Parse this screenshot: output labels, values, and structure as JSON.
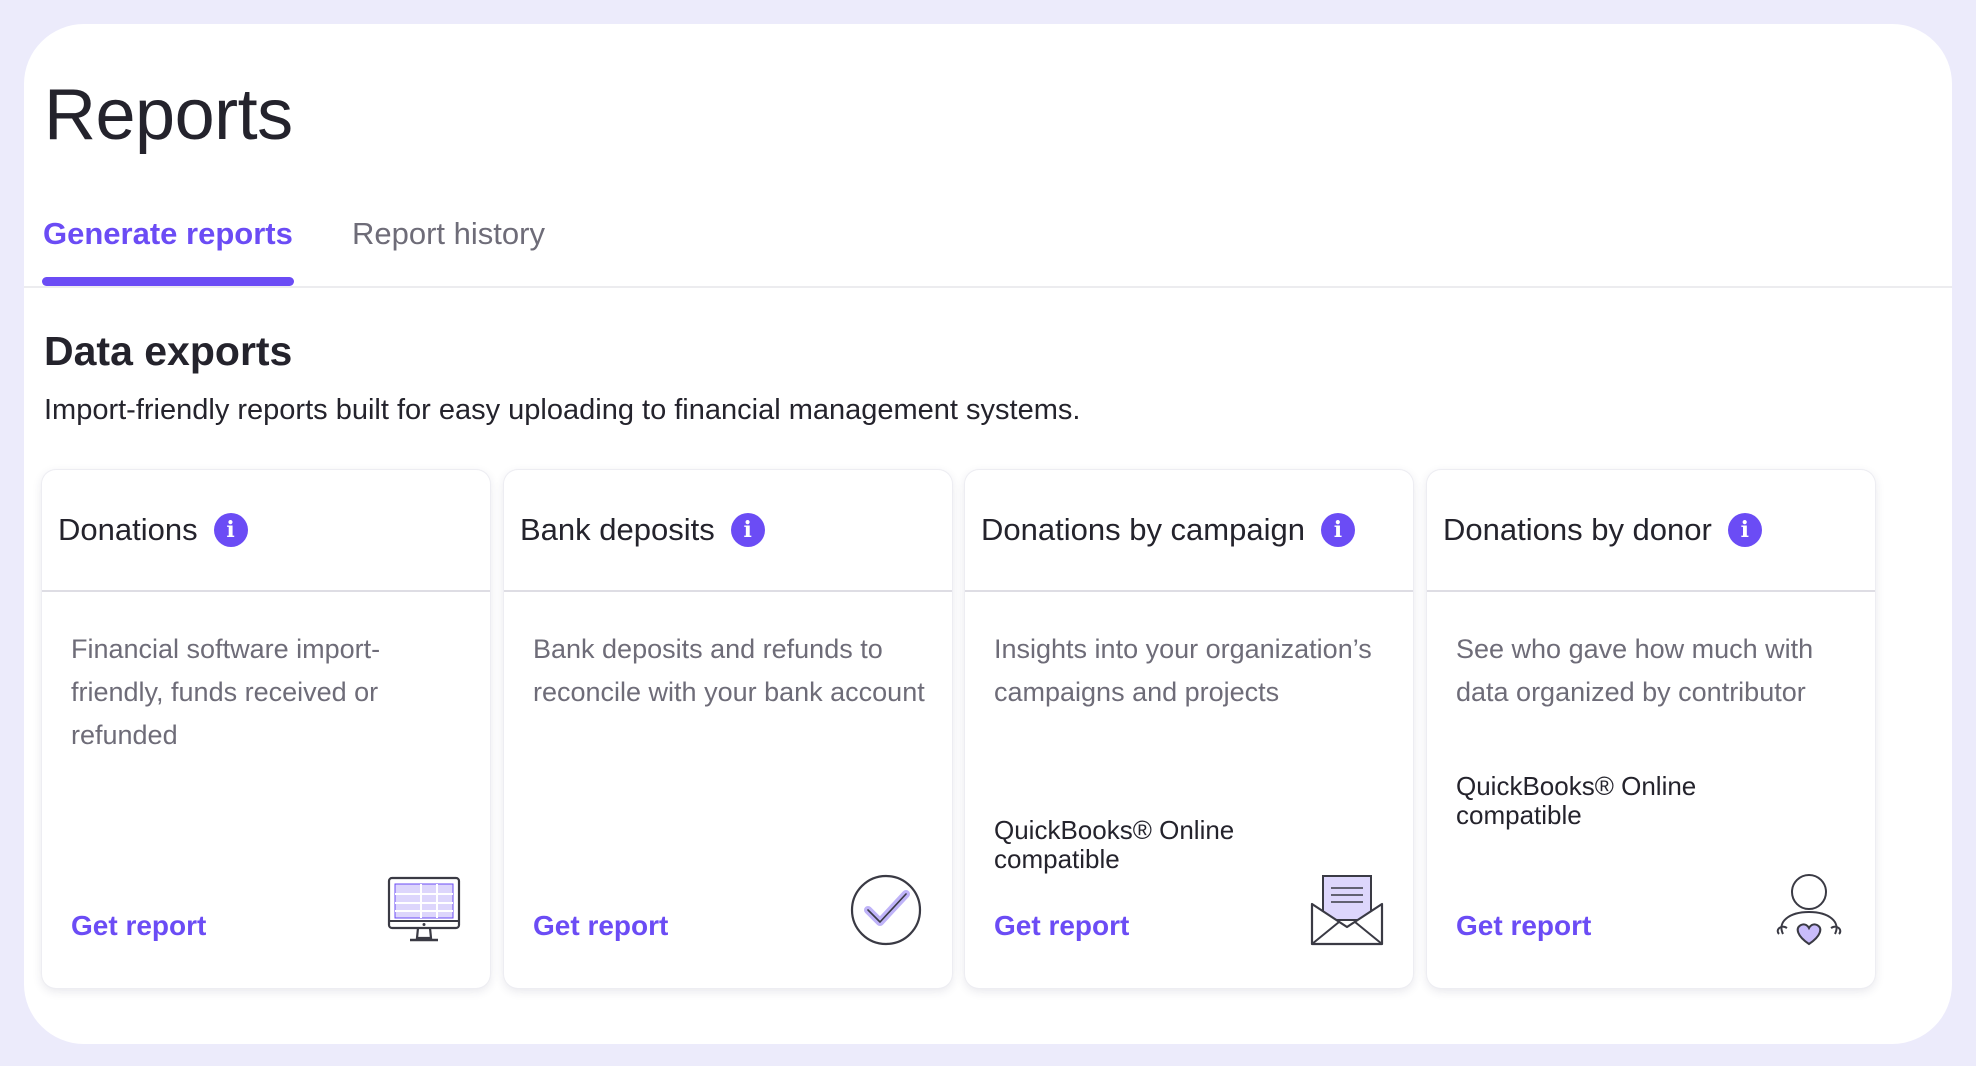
{
  "page": {
    "title": "Reports"
  },
  "tabs": [
    {
      "label": "Generate reports",
      "active": true
    },
    {
      "label": "Report history",
      "active": false
    }
  ],
  "section": {
    "title": "Data exports",
    "subtitle": "Import-friendly reports built for easy uploading to financial management systems."
  },
  "cards": [
    {
      "title": "Donations",
      "info_icon": "info-icon",
      "description": "Financial software import-friendly, funds received or refunded",
      "compat": "",
      "action": "Get report",
      "illustration": "computer-monitor-icon"
    },
    {
      "title": "Bank deposits",
      "info_icon": "info-icon",
      "description": "Bank deposits and refunds to reconcile with your bank account",
      "compat": "",
      "action": "Get report",
      "illustration": "checkmark-circle-icon"
    },
    {
      "title": "Donations by campaign",
      "info_icon": "info-icon",
      "description": "Insights into your organization’s campaigns and projects",
      "compat": "QuickBooks® Online compatible",
      "action": "Get report",
      "illustration": "envelope-icon"
    },
    {
      "title": "Donations by donor",
      "info_icon": "info-icon",
      "description": "See who gave how much with data organized by contributor",
      "compat": "QuickBooks® Online compatible",
      "action": "Get report",
      "illustration": "donor-heart-icon"
    }
  ],
  "colors": {
    "accent": "#6b4cf5",
    "background": "#ecebfb",
    "text": "#24232c",
    "muted_text": "#6e6c78"
  }
}
